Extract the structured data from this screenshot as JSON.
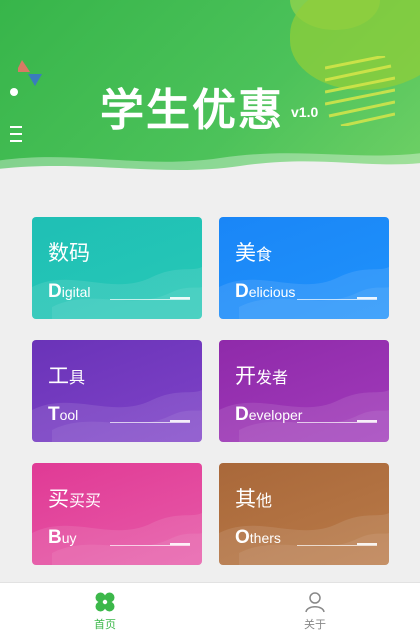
{
  "header": {
    "title": "学生优惠",
    "version": "v1.0"
  },
  "cards": [
    {
      "id": "digital",
      "cn_main": "数码",
      "cn_small": "",
      "en_initial": "D",
      "en_rest": "igital",
      "color_top": "#1fbfb5",
      "color_bottom": "#27c9b6"
    },
    {
      "id": "delicious",
      "cn_main": "美",
      "cn_small": "食",
      "en_initial": "D",
      "en_rest": "elicious",
      "color_top": "#1a86f7",
      "color_bottom": "#1f92fb"
    },
    {
      "id": "tool",
      "cn_main": "工",
      "cn_small": "具",
      "en_initial": "T",
      "en_rest": "ool",
      "color_top": "#6a33b8",
      "color_bottom": "#7f43c8"
    },
    {
      "id": "developer",
      "cn_main": "开",
      "cn_small": "发者",
      "en_initial": "D",
      "en_rest": "eveloper",
      "color_top": "#8f2aaa",
      "color_bottom": "#a13bba"
    },
    {
      "id": "buy",
      "cn_main": "买",
      "cn_small": "买买",
      "en_initial": "B",
      "en_rest": "uy",
      "color_top": "#e03a95",
      "color_bottom": "#e75aa8"
    },
    {
      "id": "others",
      "cn_main": "其",
      "cn_small": "他",
      "en_initial": "O",
      "en_rest": "thers",
      "color_top": "#a9683a",
      "color_bottom": "#b97a48"
    }
  ],
  "tabbar": {
    "home_label": "首页",
    "about_label": "关于",
    "active_color": "#3cb84a",
    "inactive_color": "#888888"
  }
}
